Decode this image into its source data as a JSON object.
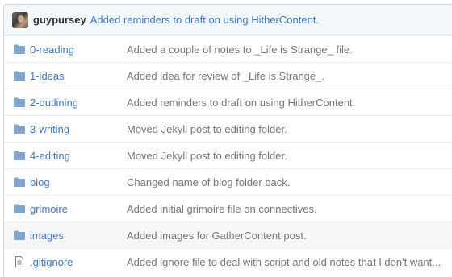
{
  "commit": {
    "author": "guypursey",
    "message": "Added reminders to draft on using HitherContent."
  },
  "files": [
    {
      "type": "folder",
      "icon": "folder-icon",
      "name": "0-reading",
      "message": "Added a couple of notes to _Life is Strange_ file."
    },
    {
      "type": "folder",
      "icon": "folder-icon",
      "name": "1-ideas",
      "message": "Added idea for review of _Life is Strange_."
    },
    {
      "type": "folder",
      "icon": "folder-icon",
      "name": "2-outlining",
      "message": "Added reminders to draft on using HitherContent."
    },
    {
      "type": "folder",
      "icon": "folder-icon",
      "name": "3-writing",
      "message": "Moved Jekyll post to editing folder."
    },
    {
      "type": "folder",
      "icon": "folder-icon",
      "name": "4-editing",
      "message": "Moved Jekyll post to editing folder."
    },
    {
      "type": "folder",
      "icon": "folder-icon",
      "name": "blog",
      "message": "Changed name of blog folder back."
    },
    {
      "type": "folder",
      "icon": "folder-icon",
      "name": "grimoire",
      "message": "Added initial grimoire file on connectives."
    },
    {
      "type": "folder",
      "icon": "folder-icon",
      "name": "images",
      "message": "Added images for GatherContent post."
    },
    {
      "type": "file",
      "icon": "file-icon",
      "name": ".gitignore",
      "message": "Added ignore file to deal with script and old notes that I don't want..."
    }
  ],
  "colors": {
    "link": "#4078c0",
    "commit_bar_bg": "#f2f8fa",
    "folder_icon": "#80a6cd",
    "message_text": "#767676"
  }
}
